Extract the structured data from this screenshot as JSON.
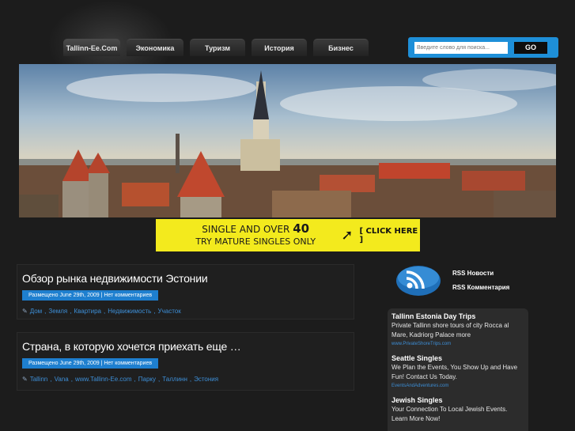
{
  "nav": {
    "tabs": [
      {
        "label": "Tallinn-Ee.Com"
      },
      {
        "label": "Экономика"
      },
      {
        "label": "Туризм"
      },
      {
        "label": "История"
      },
      {
        "label": "Бизнес"
      }
    ]
  },
  "search": {
    "placeholder": "Введите слово для поиска...",
    "button": "GO"
  },
  "banner": {
    "line1_prefix": "SINGLE AND OVER ",
    "line1_number": "40",
    "line2": "TRY MATURE SINGLES ONLY",
    "cta": "[ CLICK HERE ]"
  },
  "posts": [
    {
      "title": "Обзор рынка недвижимости Эстонии",
      "meta": "Размещено June 29th, 2009 | Нет комментариев",
      "tags": [
        "Дом",
        "Земля",
        "Квартира",
        "Недвижимость",
        "Участок"
      ]
    },
    {
      "title": "Страна, в которую хочется приехать еще …",
      "meta": "Размещено June 29th, 2009 | Нет комментариев",
      "tags": [
        "Tallinn",
        "Vana",
        "www.Tallinn-Ee.com",
        "Парку",
        "Таллинн",
        "Эстония"
      ]
    }
  ],
  "sidebar": {
    "rss_news": "RSS Новости",
    "rss_comments": "RSS Комментария",
    "ads": [
      {
        "title": "Tallinn Estonia Day Trips",
        "desc": "Private Tallinn shore tours of city Rocca al Mare, Kadriorg Palace more",
        "url": "www.PrivateShoreTrips.com"
      },
      {
        "title": "Seattle Singles",
        "desc": "We Plan the Events, You Show Up and Have Fun! Contact Us Today.",
        "url": "EventsAndAdventures.com"
      },
      {
        "title": "Jewish Singles",
        "desc": "Your Connection To Local Jewish Events. Learn More Now!",
        "url": ""
      }
    ]
  },
  "colors": {
    "accent": "#1e8fd8",
    "meta_bg": "#1e7fcf",
    "banner_bg": "#f3ea1d",
    "page_bg": "#1c1c1c"
  }
}
